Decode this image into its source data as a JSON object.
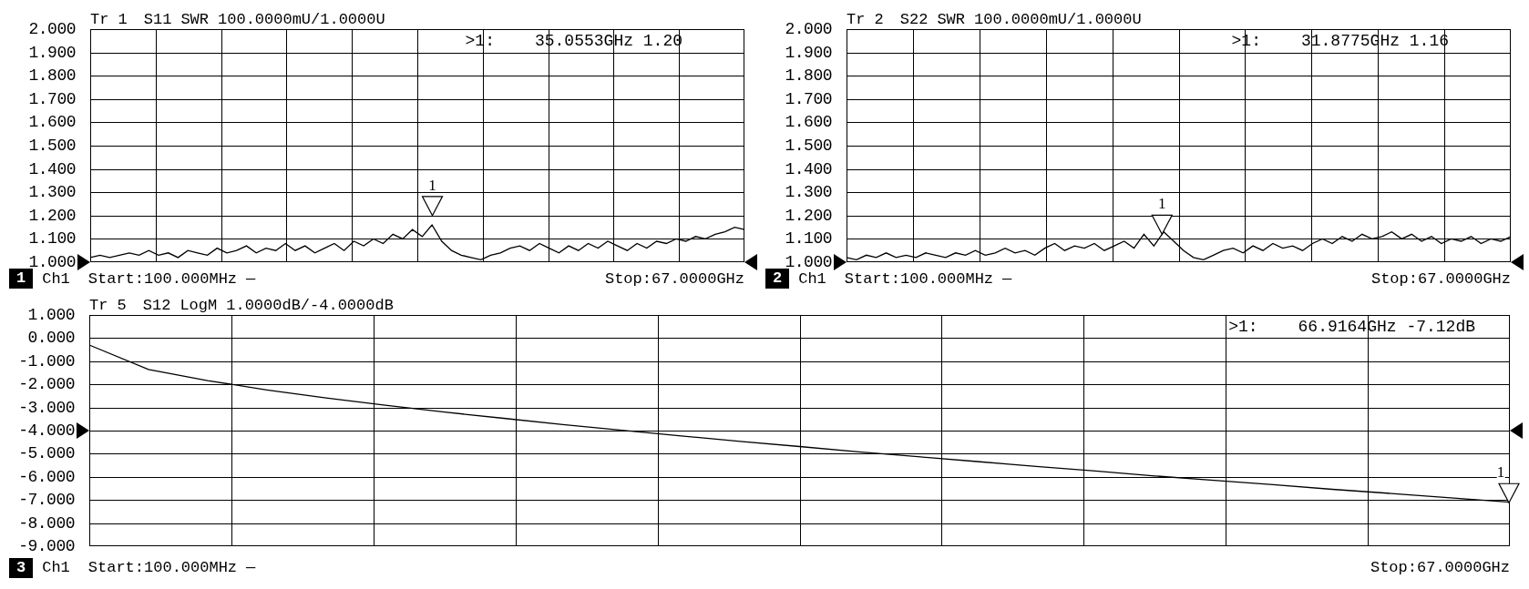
{
  "top_panels": [
    {
      "trace": "Tr 1",
      "format": "SWR",
      "scale": "100.0000mU/1.0000U",
      "readout": {
        "marker": ">1:",
        "value": "35.0553GHz 1.20"
      },
      "channel_number": "1",
      "channel": "Ch1",
      "start": "Start:100.000MHz",
      "sweep_mark": "—",
      "stop": "Stop:67.0000GHz",
      "chart_data": {
        "type": "line",
        "grid": true,
        "ylim": [
          1,
          2
        ],
        "yticks": [
          {
            "value": 2,
            "label": "2.000"
          },
          {
            "value": 1.9,
            "label": "1.900"
          },
          {
            "value": 1.8,
            "label": "1.800"
          },
          {
            "value": 1.7,
            "label": "1.700"
          },
          {
            "value": 1.6,
            "label": "1.600"
          },
          {
            "value": 1.5,
            "label": "1.500"
          },
          {
            "value": 1.4,
            "label": "1.400"
          },
          {
            "value": 1.3,
            "label": "1.300"
          },
          {
            "value": 1.2,
            "label": "1.200"
          },
          {
            "value": 1.1,
            "label": "1.100"
          },
          {
            "value": 1,
            "label": "1.000"
          }
        ],
        "categories": [
          null,
          null,
          null,
          null,
          null,
          null,
          null,
          null,
          null,
          null,
          null,
          null,
          null,
          null,
          null,
          null,
          null,
          null,
          null,
          null,
          null,
          null,
          null,
          null,
          null,
          null,
          null,
          null,
          null,
          null,
          null,
          null,
          null,
          null,
          null,
          null,
          null,
          null,
          null,
          null,
          null,
          null,
          null,
          null,
          null,
          null,
          null,
          null,
          null,
          null,
          null,
          null,
          null,
          null,
          null,
          null,
          null,
          null,
          null,
          null,
          null,
          null,
          null,
          null,
          null,
          null,
          null,
          null
        ],
        "series": [
          {
            "name": "S11",
            "color": "#000000",
            "values": [
              1.02,
              1.03,
              1.02,
              1.03,
              1.04,
              1.03,
              1.05,
              1.03,
              1.04,
              1.02,
              1.05,
              1.04,
              1.03,
              1.06,
              1.04,
              1.05,
              1.07,
              1.04,
              1.06,
              1.05,
              1.08,
              1.05,
              1.07,
              1.04,
              1.06,
              1.08,
              1.05,
              1.09,
              1.07,
              1.1,
              1.08,
              1.12,
              1.1,
              1.14,
              1.11,
              1.16,
              1.09,
              1.05,
              1.03,
              1.02,
              1.01,
              1.03,
              1.04,
              1.06,
              1.07,
              1.05,
              1.08,
              1.06,
              1.04,
              1.07,
              1.05,
              1.08,
              1.06,
              1.09,
              1.07,
              1.05,
              1.08,
              1.06,
              1.09,
              1.08,
              1.1,
              1.09,
              1.11,
              1.1,
              1.12,
              1.13,
              1.15,
              1.14
            ]
          }
        ],
        "annotations": [
          "1"
        ]
      }
    },
    {
      "trace": "Tr 2",
      "format": "SWR",
      "scale": "100.0000mU/1.0000U",
      "readout": {
        "marker": ">1:",
        "value": "31.8775GHz 1.16"
      },
      "channel_number": "2",
      "channel": "Ch1",
      "start": "Start:100.000MHz",
      "sweep_mark": "—",
      "stop": "Stop:67.0000GHz",
      "chart_data": {
        "type": "line",
        "grid": true,
        "ylim": [
          1,
          2
        ],
        "yticks": [
          {
            "value": 2,
            "label": "2.000"
          },
          {
            "value": 1.9,
            "label": "1.900"
          },
          {
            "value": 1.8,
            "label": "1.800"
          },
          {
            "value": 1.7,
            "label": "1.700"
          },
          {
            "value": 1.6,
            "label": "1.600"
          },
          {
            "value": 1.5,
            "label": "1.500"
          },
          {
            "value": 1.4,
            "label": "1.400"
          },
          {
            "value": 1.3,
            "label": "1.300"
          },
          {
            "value": 1.2,
            "label": "1.200"
          },
          {
            "value": 1.1,
            "label": "1.100"
          },
          {
            "value": 1,
            "label": "1.000"
          }
        ],
        "categories": [
          null,
          null,
          null,
          null,
          null,
          null,
          null,
          null,
          null,
          null,
          null,
          null,
          null,
          null,
          null,
          null,
          null,
          null,
          null,
          null,
          null,
          null,
          null,
          null,
          null,
          null,
          null,
          null,
          null,
          null,
          null,
          null,
          null,
          null,
          null,
          null,
          null,
          null,
          null,
          null,
          null,
          null,
          null,
          null,
          null,
          null,
          null,
          null,
          null,
          null,
          null,
          null,
          null,
          null,
          null,
          null,
          null,
          null,
          null,
          null,
          null,
          null,
          null,
          null,
          null,
          null,
          null,
          null
        ],
        "series": [
          {
            "name": "S22",
            "color": "#000000",
            "values": [
              1.02,
              1.01,
              1.03,
              1.02,
              1.04,
              1.02,
              1.03,
              1.02,
              1.04,
              1.03,
              1.02,
              1.04,
              1.03,
              1.05,
              1.03,
              1.04,
              1.06,
              1.04,
              1.05,
              1.03,
              1.06,
              1.08,
              1.05,
              1.07,
              1.06,
              1.08,
              1.05,
              1.07,
              1.09,
              1.06,
              1.12,
              1.07,
              1.13,
              1.09,
              1.05,
              1.02,
              1.01,
              1.03,
              1.05,
              1.06,
              1.04,
              1.07,
              1.05,
              1.08,
              1.06,
              1.07,
              1.05,
              1.08,
              1.1,
              1.08,
              1.11,
              1.09,
              1.12,
              1.1,
              1.11,
              1.13,
              1.1,
              1.12,
              1.09,
              1.11,
              1.08,
              1.1,
              1.09,
              1.11,
              1.08,
              1.1,
              1.09,
              1.11
            ]
          }
        ],
        "annotations": [
          "1"
        ]
      }
    }
  ],
  "bottom_panel": {
    "trace": "Tr 5",
    "format": "LogM",
    "scale": "1.0000dB/-4.0000dB",
    "readout": {
      "marker": ">1:",
      "value": "66.9164GHz -7.12dB"
    },
    "channel_number": "3",
    "channel": "Ch1",
    "start": "Start:100.000MHz",
    "sweep_mark": "—",
    "stop": "Stop:67.0000GHz",
    "chart_data": {
      "type": "line",
      "grid": true,
      "ylim": [
        -9,
        1
      ],
      "yticks": [
        {
          "value": 1,
          "label": "1.000"
        },
        {
          "value": 0,
          "label": "0.000"
        },
        {
          "value": -1,
          "label": "-1.000"
        },
        {
          "value": -2,
          "label": "-2.000"
        },
        {
          "value": -3,
          "label": "-3.000"
        },
        {
          "value": -4,
          "label": "-4.000"
        },
        {
          "value": -5,
          "label": "-5.000"
        },
        {
          "value": -6,
          "label": "-6.000"
        },
        {
          "value": -7,
          "label": "-7.000"
        },
        {
          "value": -8,
          "label": "-8.000"
        },
        {
          "value": -9,
          "label": "-9.000"
        }
      ],
      "categories": [
        null,
        null,
        null,
        null,
        null,
        null,
        null,
        null,
        null,
        null,
        null,
        null,
        null,
        null,
        null,
        null,
        null,
        null,
        null,
        null,
        null,
        null,
        null,
        null,
        null
      ],
      "series": [
        {
          "name": "S12",
          "color": "#000000",
          "values": [
            -0.3,
            -1.36,
            -1.84,
            -2.24,
            -2.59,
            -2.9,
            -3.2,
            -3.47,
            -3.74,
            -3.99,
            -4.23,
            -4.47,
            -4.69,
            -4.92,
            -5.13,
            -5.34,
            -5.55,
            -5.75,
            -5.96,
            -6.15,
            -6.34,
            -6.54,
            -6.72,
            -6.91,
            -7.1
          ]
        }
      ],
      "annotations": [
        "1"
      ]
    }
  }
}
